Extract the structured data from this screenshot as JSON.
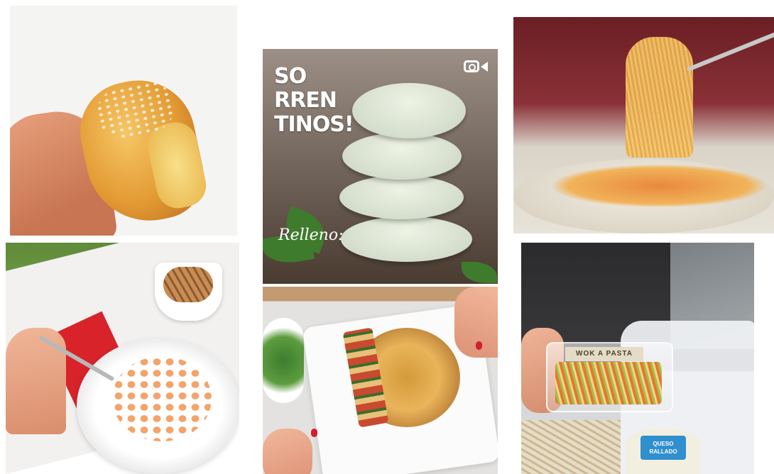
{
  "grid": {
    "posts": [
      {
        "alt_name": "bread-post"
      },
      {
        "alt_name": "sorrentinos-post",
        "title": "SO\nRREN\nTINOS!",
        "script_text": "Relleno:",
        "video_icon": "video-camera-icon"
      },
      {
        "alt_name": "spaghetti-post"
      },
      {
        "alt_name": "gnocchi-post"
      },
      {
        "alt_name": "quiche-post"
      },
      {
        "alt_name": "packaged-pasta-post",
        "box_label": "WOK A PASTA",
        "cup_label": "QUESO\nRALLADO"
      }
    ]
  },
  "colors": {
    "background": "#ffffff",
    "brand_blue": "#2f8fcf",
    "napkin_red": "#d8232a"
  }
}
